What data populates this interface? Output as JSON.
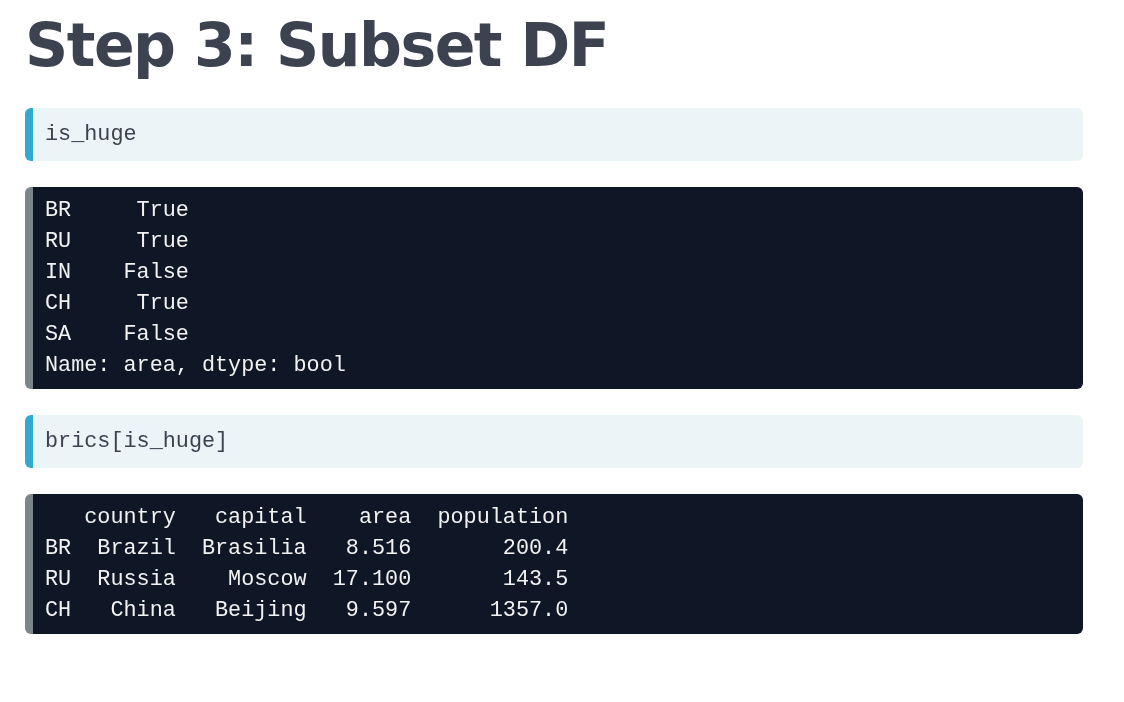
{
  "title": "Step 3: Subset DF",
  "blocks": [
    {
      "kind": "input",
      "lines": [
        "is_huge"
      ]
    },
    {
      "kind": "output",
      "lines": [
        "BR     True",
        "RU     True",
        "IN    False",
        "CH     True",
        "SA    False",
        "Name: area, dtype: bool"
      ]
    },
    {
      "kind": "input",
      "lines": [
        "brics[is_huge]"
      ]
    },
    {
      "kind": "output",
      "lines": [
        "   country   capital    area  population",
        "BR  Brazil  Brasilia   8.516       200.4",
        "RU  Russia    Moscow  17.100       143.5",
        "CH   China   Beijing   9.597      1357.0"
      ]
    }
  ]
}
